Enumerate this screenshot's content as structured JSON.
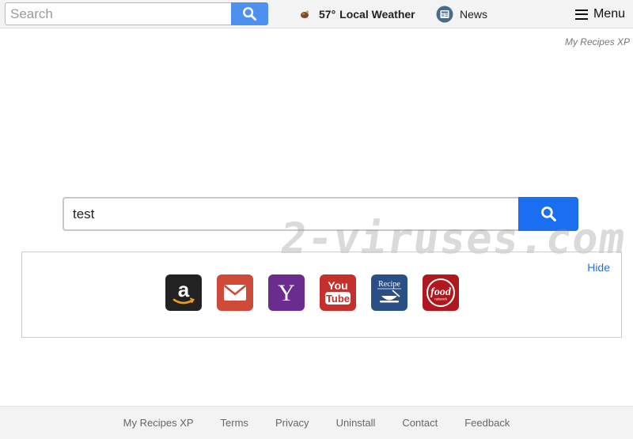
{
  "topbar": {
    "search_placeholder": "Search",
    "search_icon": "search-icon",
    "weather": {
      "icon": "weather-icon",
      "temp": "57°",
      "label": "Local Weather"
    },
    "news": {
      "icon": "news-icon",
      "label": "News"
    },
    "menu": {
      "icon": "hamburger-icon",
      "label": "Menu"
    }
  },
  "brand": "My Recipes XP",
  "main_search": {
    "value": "test",
    "icon": "search-icon"
  },
  "watermark": "2-viruses.com",
  "shortcuts": {
    "hide_label": "Hide",
    "tiles": [
      {
        "name": "amazon",
        "glyph": "a",
        "bg": "#222222"
      },
      {
        "name": "gmail",
        "glyph": "mail",
        "bg": "#d04a3a"
      },
      {
        "name": "yahoo",
        "glyph": "Y",
        "bg": "#6b2c8f"
      },
      {
        "name": "youtube",
        "glyph_top": "You",
        "glyph_bottom": "Tube",
        "bg": "#c4302b"
      },
      {
        "name": "recipe",
        "glyph": "Recipe",
        "bg": "#2a4f85"
      },
      {
        "name": "food-network",
        "glyph": "food",
        "glyph_small": "network",
        "bg": "#b01820"
      }
    ]
  },
  "footer": {
    "links": [
      "My Recipes XP",
      "Terms",
      "Privacy",
      "Uninstall",
      "Contact",
      "Feedback"
    ]
  },
  "colors": {
    "top_search_button": "#4d90f0",
    "main_search_button": "#1a6ef0",
    "link": "#2a6fd6"
  }
}
